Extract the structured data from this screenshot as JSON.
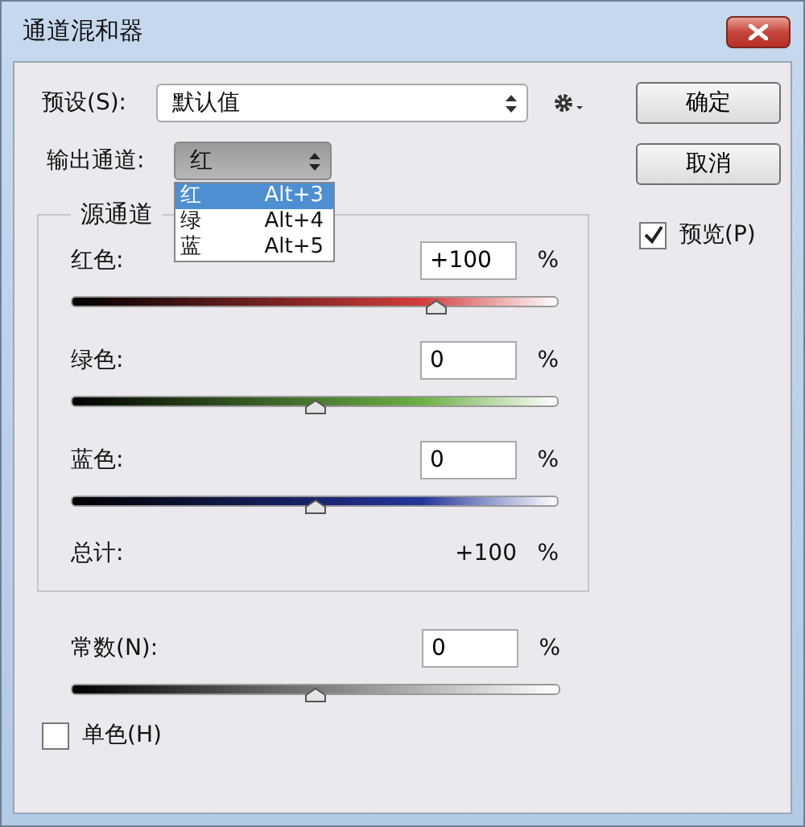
{
  "window": {
    "title": "通道混和器"
  },
  "preset": {
    "label": "预设(S):",
    "value": "默认值"
  },
  "output_channel": {
    "label": "输出通道:",
    "value": "红",
    "expanded": true,
    "options": [
      {
        "label": "红",
        "shortcut": "Alt+3",
        "selected": true
      },
      {
        "label": "绿",
        "shortcut": "Alt+4",
        "selected": false
      },
      {
        "label": "蓝",
        "shortcut": "Alt+5",
        "selected": false
      }
    ]
  },
  "source_channels": {
    "title": "源通道",
    "channels": [
      {
        "label": "红色:",
        "value": "+100",
        "unit": "%",
        "level": 0.75,
        "color": "#d23c3c"
      },
      {
        "label": "绿色:",
        "value": "0",
        "unit": "%",
        "level": 0.5,
        "color": "#6cb046"
      },
      {
        "label": "蓝色:",
        "value": "0",
        "unit": "%",
        "level": 0.5,
        "color": "#24359c"
      }
    ],
    "total": {
      "label": "总计:",
      "value": "+100",
      "unit": "%"
    }
  },
  "constant": {
    "label": "常数(N):",
    "value": "0",
    "unit": "%",
    "level": 0.5
  },
  "buttons": [
    {
      "label": "确定"
    },
    {
      "label": "取消"
    }
  ],
  "preview": {
    "label": "预览(P)",
    "checked": true
  },
  "monochrome": {
    "label": "单色(H)",
    "checked": false
  }
}
